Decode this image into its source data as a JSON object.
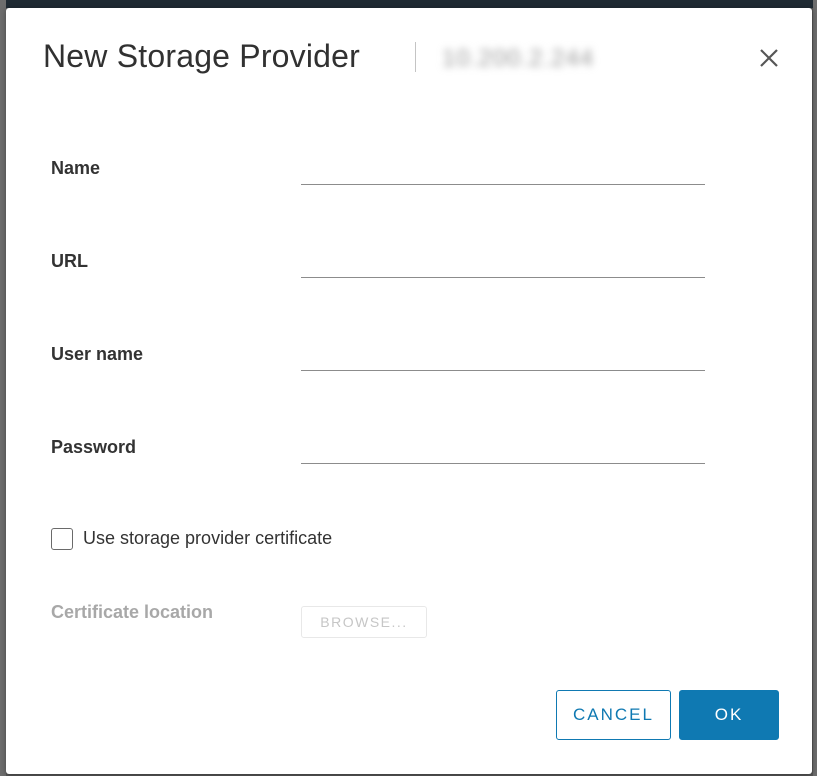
{
  "dialog": {
    "title": "New Storage Provider",
    "host_name": "10.200.2.244",
    "close_icon": "close-icon"
  },
  "form": {
    "name_label": "Name",
    "name_value": "",
    "url_label": "URL",
    "url_value": "",
    "username_label": "User name",
    "username_value": "",
    "password_label": "Password",
    "password_value": "",
    "use_certificate_label": "Use storage provider certificate",
    "use_certificate_checked": false,
    "certificate_location_label": "Certificate location",
    "browse_label": "BROWSE..."
  },
  "footer": {
    "cancel_label": "CANCEL",
    "ok_label": "OK"
  },
  "colors": {
    "accent": "#0f79b2",
    "text": "#333333",
    "disabled_text": "#a8a8a8"
  }
}
